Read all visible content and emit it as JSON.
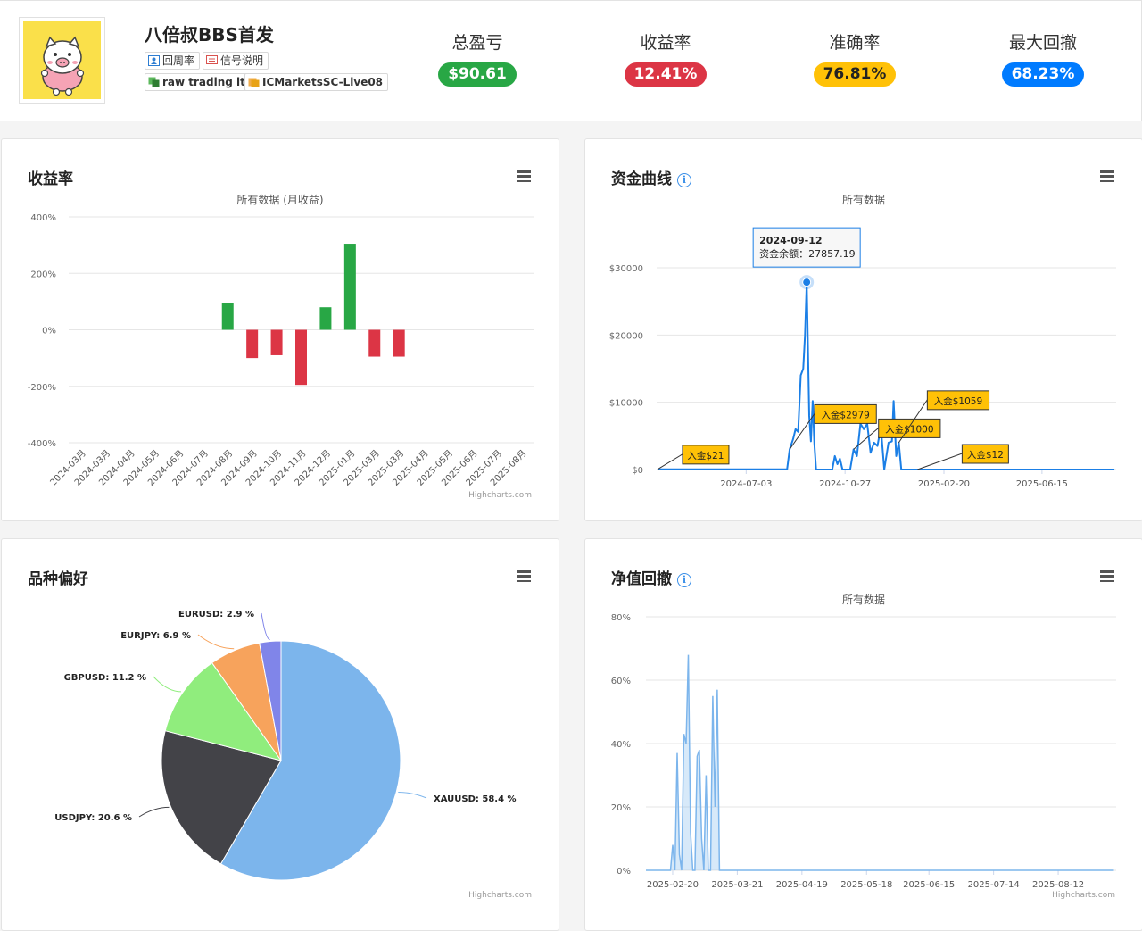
{
  "header": {
    "account_name": "八倍叔BBS首发",
    "tags": [
      {
        "label": "回周率",
        "icon": "person-icon"
      },
      {
        "label": "信号说明",
        "icon": "document-icon"
      },
      {
        "label": "raw trading ltd",
        "icon": "broker-icon"
      },
      {
        "label": "ICMarketsSC-Live08",
        "icon": "server-icon"
      }
    ],
    "stats": [
      {
        "label": "总盈亏",
        "value": "$90.61",
        "color": "#28a745"
      },
      {
        "label": "收益率",
        "value": "12.41%",
        "color": "#dc3545"
      },
      {
        "label": "准确率",
        "value": "76.81%",
        "color": "#ffc107"
      },
      {
        "label": "最大回撤",
        "value": "68.23%",
        "color": "#007bff"
      }
    ]
  },
  "panels": {
    "returns": {
      "title": "收益率",
      "subtitle": "所有数据 (月收益)",
      "credit": "Highcharts.com"
    },
    "equity": {
      "title": "资金曲线",
      "subtitle": "所有数据",
      "credit": ""
    },
    "symbols": {
      "title": "品种偏好",
      "credit": "Highcharts.com"
    },
    "drawdown": {
      "title": "净值回撤",
      "subtitle": "所有数据",
      "credit": "Highcharts.com"
    }
  },
  "chart_data": [
    {
      "type": "bar",
      "title": "收益率",
      "subtitle": "所有数据 (月收益)",
      "categories": [
        "2024-03月",
        "2024-03月",
        "2024-04月",
        "2024-05月",
        "2024-06月",
        "2024-07月",
        "2024-08月",
        "2024-09月",
        "2024-10月",
        "2024-11月",
        "2024-12月",
        "2025-01月",
        "2025-03月",
        "2025-03月",
        "2025-04月",
        "2025-05月",
        "2025-06月",
        "2025-07月",
        "2025-08月"
      ],
      "values": [
        0,
        0,
        0,
        0,
        0,
        0,
        95,
        -100,
        -90,
        -195,
        80,
        305,
        -95,
        -95,
        0,
        0,
        0,
        0,
        0
      ],
      "ylim": [
        -400,
        400
      ],
      "yticks": [
        "400%",
        "200%",
        "0%",
        "-200%",
        "-400%"
      ],
      "colors": {
        "positive": "#28a745",
        "negative": "#dc3545"
      }
    },
    {
      "type": "line",
      "title": "资金曲线",
      "subtitle": "所有数据",
      "x_ticks": [
        "2024-07-03",
        "2024-10-27",
        "2025-02-20",
        "2025-06-15"
      ],
      "y_ticks": [
        "$30000",
        "$20000",
        "$10000",
        "$0"
      ],
      "ylim": [
        0,
        30000
      ],
      "xlim": [
        "2024-03-20",
        "2025-09-10"
      ],
      "series": [
        {
          "color": "#1b7fe6",
          "points": [
            [
              "2024-03-21",
              21
            ],
            [
              "2024-07-01",
              21
            ],
            [
              "2024-08-20",
              21
            ],
            [
              "2024-08-23",
              3000
            ],
            [
              "2024-08-27",
              4500
            ],
            [
              "2024-08-30",
              6000
            ],
            [
              "2024-09-02",
              5600
            ],
            [
              "2024-09-05",
              14000
            ],
            [
              "2024-09-08",
              15000
            ],
            [
              "2024-09-10",
              20000
            ],
            [
              "2024-09-12",
              27857.19
            ],
            [
              "2024-09-15",
              8000
            ],
            [
              "2024-09-17",
              4200
            ],
            [
              "2024-09-19",
              10200
            ],
            [
              "2024-09-21",
              3800
            ],
            [
              "2024-09-23",
              0
            ],
            [
              "2024-10-12",
              0
            ],
            [
              "2024-10-15",
              2000
            ],
            [
              "2024-10-18",
              800
            ],
            [
              "2024-10-21",
              1600
            ],
            [
              "2024-10-24",
              0
            ],
            [
              "2024-11-02",
              0
            ],
            [
              "2024-11-06",
              3000
            ],
            [
              "2024-11-10",
              2000
            ],
            [
              "2024-11-14",
              6800
            ],
            [
              "2024-11-18",
              6000
            ],
            [
              "2024-11-22",
              6800
            ],
            [
              "2024-11-26",
              2500
            ],
            [
              "2024-11-30",
              4000
            ],
            [
              "2024-12-04",
              3500
            ],
            [
              "2024-12-08",
              6300
            ],
            [
              "2024-12-12",
              0
            ],
            [
              "2024-12-17",
              4000
            ],
            [
              "2024-12-21",
              4200
            ],
            [
              "2024-12-23",
              10200
            ],
            [
              "2024-12-26",
              2000
            ],
            [
              "2024-12-29",
              4000
            ],
            [
              "2025-01-01",
              0
            ],
            [
              "2025-01-20",
              0
            ],
            [
              "2025-03-01",
              0
            ],
            [
              "2025-09-08",
              0
            ]
          ]
        }
      ],
      "tooltip": {
        "date": "2024-09-12",
        "label": "资金余额：27857.19"
      },
      "annotations": [
        {
          "text": "入金$21",
          "date": "2024-03-21",
          "value": 21
        },
        {
          "text": "入金$2979",
          "date": "2024-08-23",
          "value": 3000
        },
        {
          "text": "入金$1000",
          "date": "2024-11-06",
          "value": 3000
        },
        {
          "text": "入金$1059",
          "date": "2024-12-29",
          "value": 4000
        },
        {
          "text": "入金$12",
          "date": "2025-01-20",
          "value": 0
        }
      ]
    },
    {
      "type": "pie",
      "title": "品种偏好",
      "slices": [
        {
          "label": "XAUUSD: 58.4 %",
          "value": 58.4,
          "color": "#7cb5ec"
        },
        {
          "label": "USDJPY: 20.6 %",
          "value": 20.6,
          "color": "#434348"
        },
        {
          "label": "GBPUSD: 11.2 %",
          "value": 11.2,
          "color": "#90ed7d"
        },
        {
          "label": "EURJPY: 6.9 %",
          "value": 6.9,
          "color": "#f7a35c"
        },
        {
          "label": "EURUSD: 2.9 %",
          "value": 2.9,
          "color": "#8085e9"
        }
      ]
    },
    {
      "type": "area",
      "title": "净值回撤",
      "subtitle": "所有数据",
      "x_ticks": [
        "2025-02-20",
        "2025-03-21",
        "2025-04-19",
        "2025-05-18",
        "2025-06-15",
        "2025-07-14",
        "2025-08-12"
      ],
      "y_ticks": [
        "80%",
        "60%",
        "40%",
        "20%",
        "0%"
      ],
      "ylim": [
        0,
        80
      ],
      "xlim": [
        "2025-02-08",
        "2025-09-07"
      ],
      "series": [
        {
          "color": "#7cb5ec",
          "points": [
            [
              "2025-02-08",
              0
            ],
            [
              "2025-02-19",
              0
            ],
            [
              "2025-02-20",
              8
            ],
            [
              "2025-02-21",
              0
            ],
            [
              "2025-02-22",
              37
            ],
            [
              "2025-02-23",
              5
            ],
            [
              "2025-02-24",
              0
            ],
            [
              "2025-02-25",
              43
            ],
            [
              "2025-02-26",
              40
            ],
            [
              "2025-02-27",
              68
            ],
            [
              "2025-02-28",
              12
            ],
            [
              "2025-03-01",
              0
            ],
            [
              "2025-03-02",
              0
            ],
            [
              "2025-03-03",
              36
            ],
            [
              "2025-03-04",
              38
            ],
            [
              "2025-03-05",
              10
            ],
            [
              "2025-03-06",
              0
            ],
            [
              "2025-03-07",
              30
            ],
            [
              "2025-03-08",
              0
            ],
            [
              "2025-03-09",
              0
            ],
            [
              "2025-03-10",
              55
            ],
            [
              "2025-03-11",
              20
            ],
            [
              "2025-03-12",
              57
            ],
            [
              "2025-03-13",
              0
            ],
            [
              "2025-09-06",
              0
            ]
          ]
        }
      ]
    }
  ]
}
